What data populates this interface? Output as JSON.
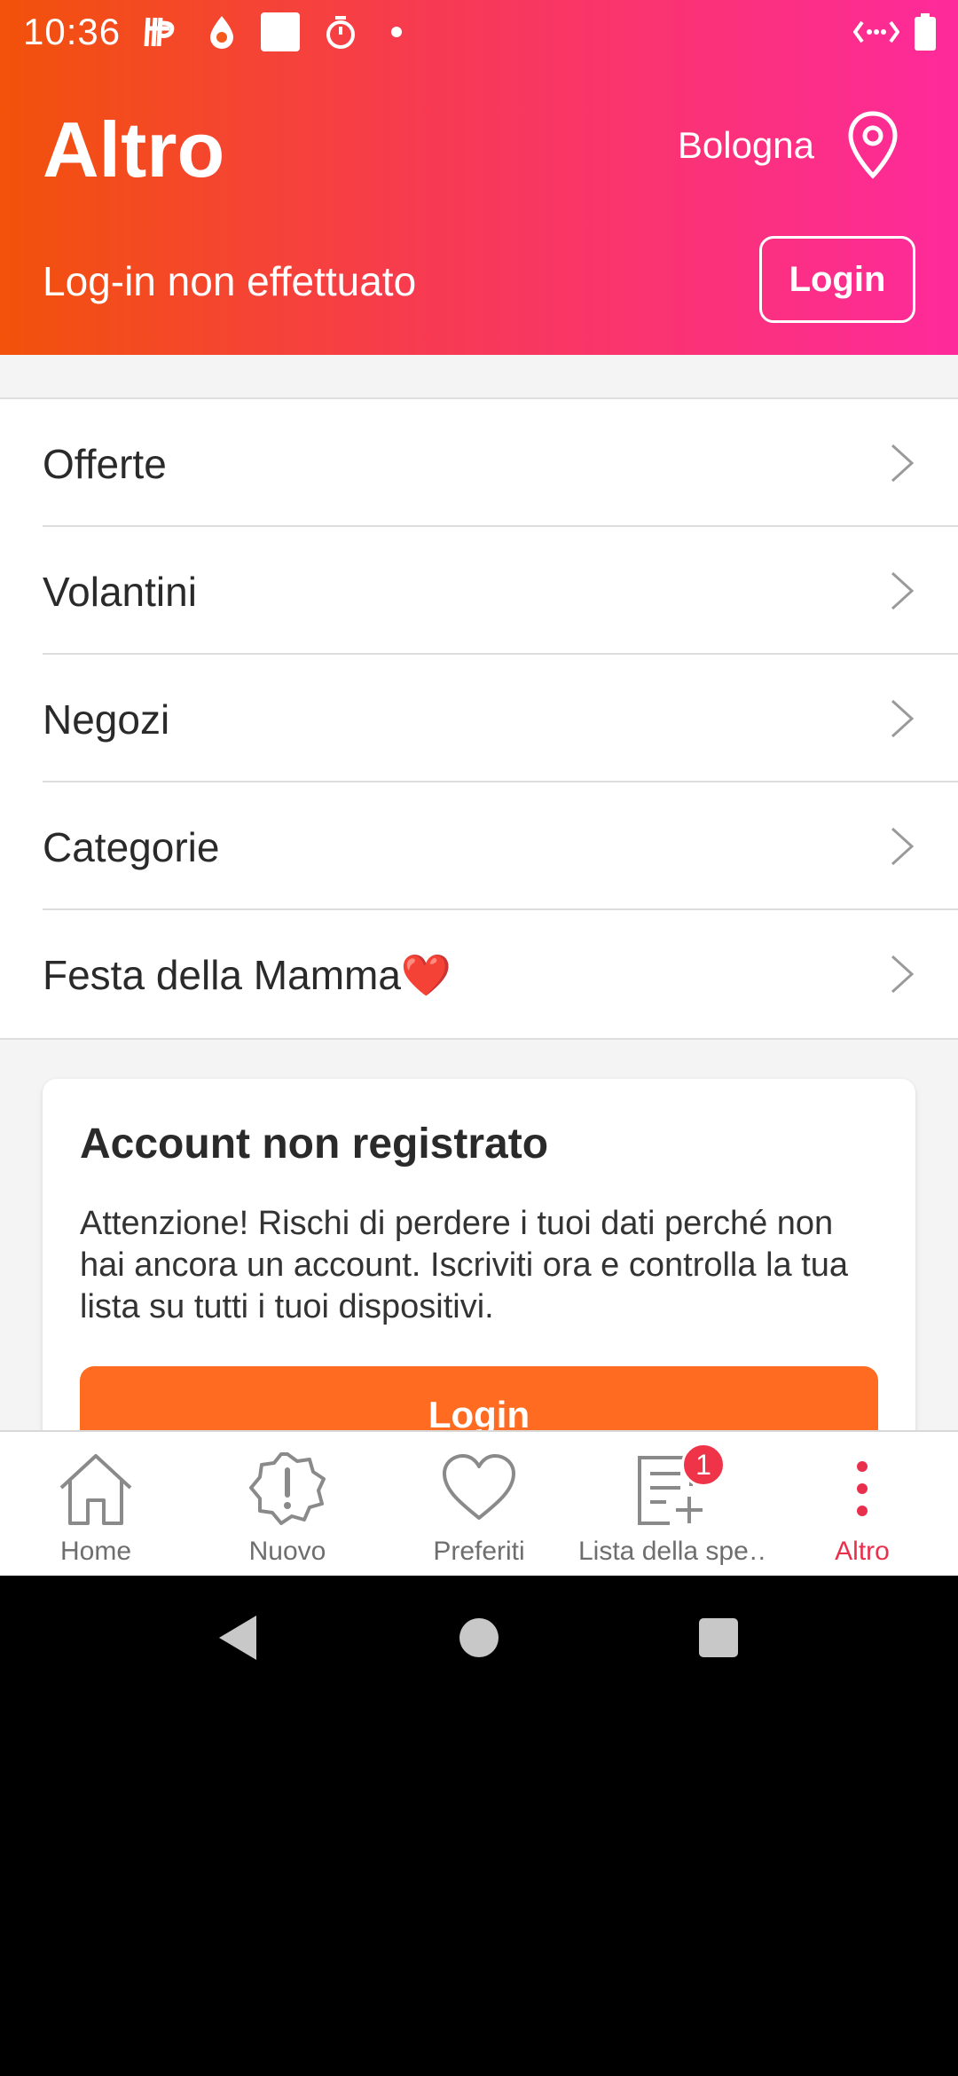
{
  "status_bar": {
    "time": "10:36",
    "left_icons": [
      "signal-mark-icon",
      "drop-icon",
      "square-icon",
      "stopwatch-icon",
      "dot-icon"
    ],
    "right_icons": [
      "cast-icon",
      "battery-icon"
    ]
  },
  "header": {
    "title": "Altro",
    "city": "Bologna",
    "login_status": "Log-in non effettuato",
    "login_button": "Login",
    "gradient": [
      "#f2520a",
      "#f73a52",
      "#fe2a9c"
    ]
  },
  "menu": {
    "items": [
      {
        "label": "Offerte"
      },
      {
        "label": "Volantini"
      },
      {
        "label": "Negozi"
      },
      {
        "label": "Categorie"
      },
      {
        "label": "Festa della Mamma",
        "emoji": "❤️"
      }
    ]
  },
  "card": {
    "title": "Account non registrato",
    "text": "Attenzione! Rischi di perdere i tuoi dati perché non hai ancora un account. Iscriviti ora e controlla la tua lista su tutti i tuoi dispositivi.",
    "button": "Login",
    "button_color": "#ff6b20"
  },
  "bottom_nav": {
    "items": [
      {
        "label": "Home",
        "icon": "home-icon"
      },
      {
        "label": "Nuovo",
        "icon": "new-badge-icon"
      },
      {
        "label": "Preferiti",
        "icon": "heart-icon"
      },
      {
        "label": "Lista della spe…",
        "icon": "shopping-list-icon",
        "badge": "1"
      },
      {
        "label": "Altro",
        "icon": "more-vertical-icon",
        "active": true
      }
    ],
    "active_color": "#e8304d"
  }
}
